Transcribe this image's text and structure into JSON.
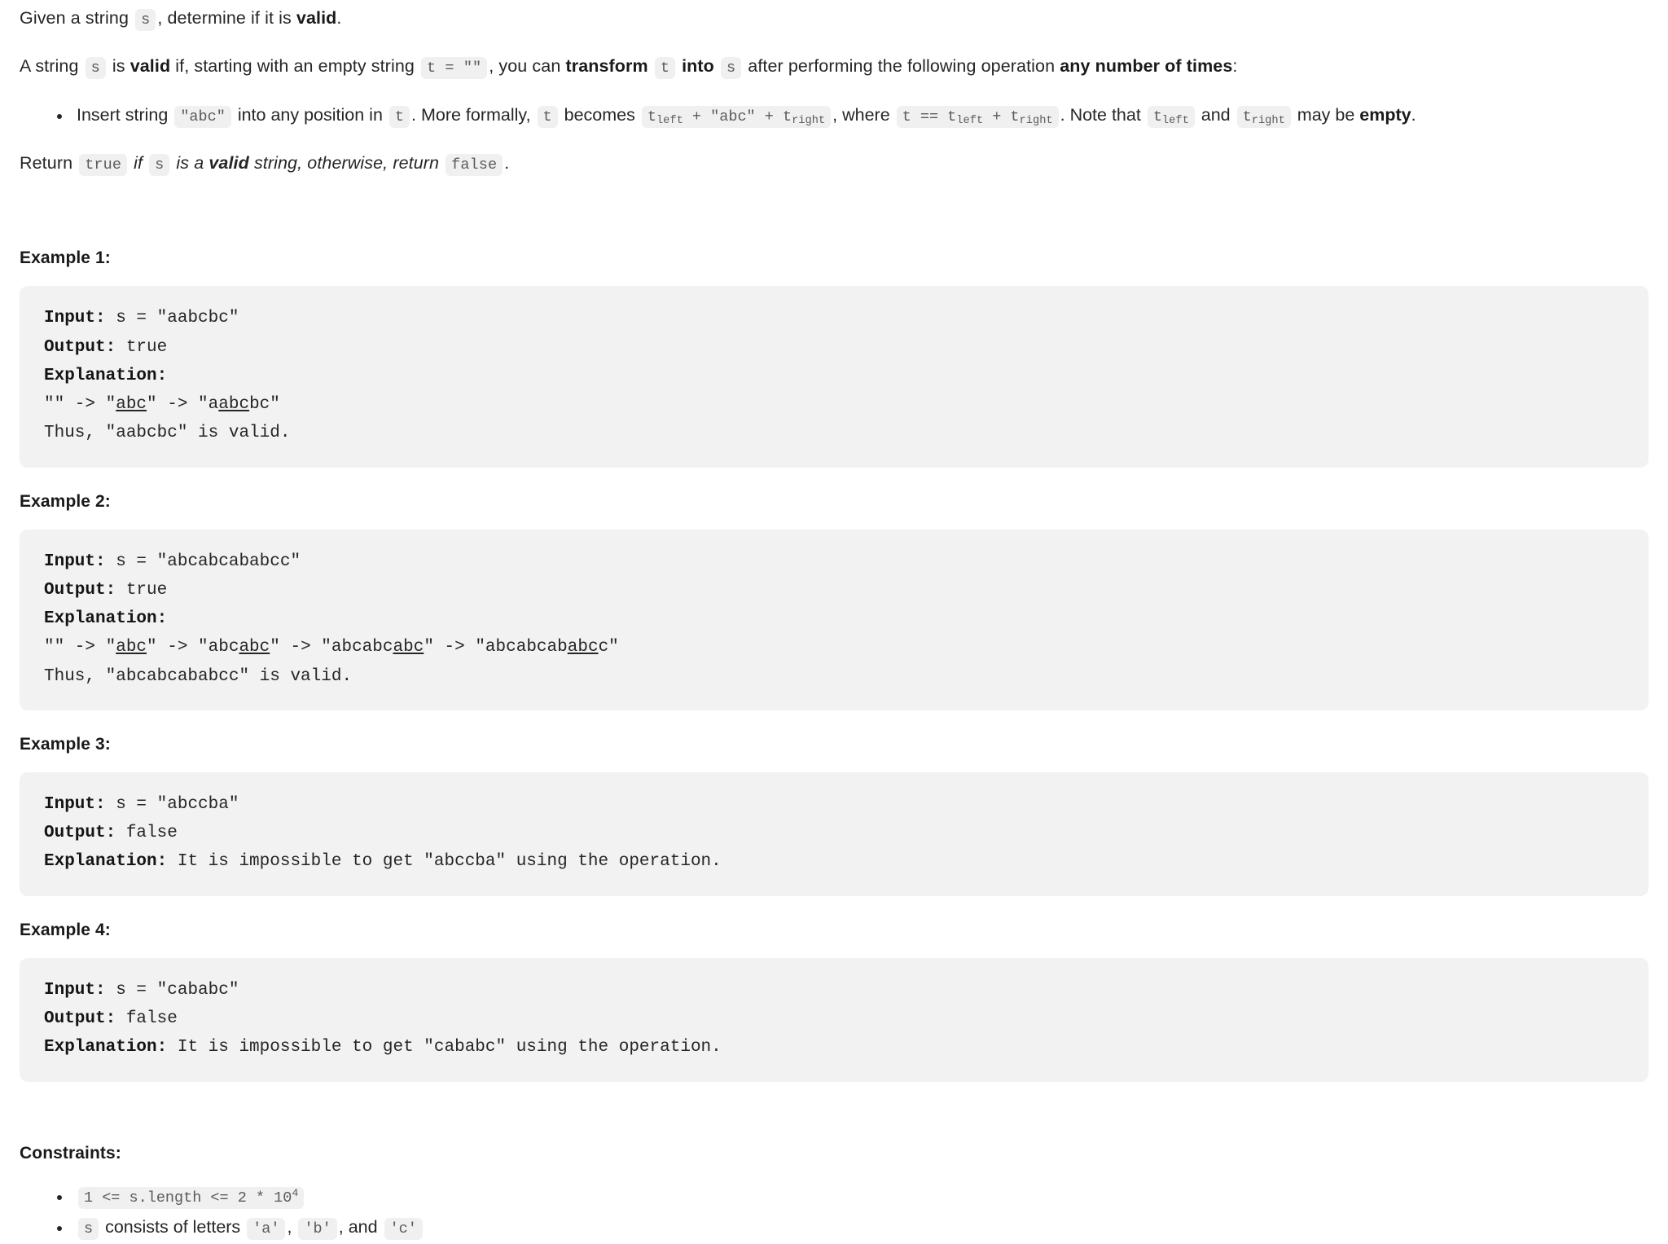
{
  "intro": {
    "line1": {
      "pre": "Given a string",
      "code_s": "s",
      "mid": ", determine if it is",
      "bold_valid": "valid",
      "post": "."
    },
    "line2": {
      "t1": "A string",
      "code_s": "s",
      "t2": "is",
      "bold_valid": "valid",
      "t3": "if, starting with an empty string",
      "code_t_empty": "t = \"\"",
      "t4": ", you can",
      "bold_transform": "transform",
      "code_t": "t",
      "bold_into": "into",
      "code_s2": "s",
      "t5": "after performing the following operation",
      "bold_any": "any number of times",
      "t6": ":"
    },
    "bullet": {
      "t1": "Insert string",
      "code_abc": "\"abc\"",
      "t2": "into any position in",
      "code_t": "t",
      "t3": ". More formally,",
      "code_t2": "t",
      "t4": "becomes",
      "code_formula": "t_left + \"abc\" + t_right",
      "t5": ", where",
      "code_eq": "t == t_left + t_right",
      "t6": ". Note that",
      "code_tleft": "t_left",
      "t7": "and",
      "code_tright": "t_right",
      "t8": "may be",
      "bold_empty": "empty",
      "t9": "."
    },
    "line3": {
      "t1": "Return",
      "code_true": "true",
      "t2": "if",
      "code_s": "s",
      "t3": "is a",
      "bold_valid": "valid",
      "t4": "string, otherwise, return",
      "code_false": "false",
      "t5": "."
    }
  },
  "examples": [
    {
      "heading": "Example 1:",
      "input_label": "Input:",
      "input_value": " s = \"aabcbc\"",
      "output_label": "Output:",
      "output_value": " true",
      "explanation_label": "Explanation:",
      "explanation_inline": "",
      "chain": [
        {
          "prefix": "\"\" -> \"",
          "pre": "",
          "underline": "abc",
          "post": "",
          "suffix": "\""
        },
        {
          "prefix": " -> \"",
          "pre": "a",
          "underline": "abc",
          "post": "bc",
          "suffix": "\""
        }
      ],
      "chain_text": "\"\" -> \"abc\" -> \"aabcbc\"",
      "closing": "Thus, \"aabcbc\" is valid."
    },
    {
      "heading": "Example 2:",
      "input_label": "Input:",
      "input_value": " s = \"abcabcababcc\"",
      "output_label": "Output:",
      "output_value": " true",
      "explanation_label": "Explanation:",
      "explanation_inline": "",
      "chain": [
        {
          "prefix": "\"\" -> \"",
          "pre": "",
          "underline": "abc",
          "post": "",
          "suffix": "\""
        },
        {
          "prefix": " -> \"",
          "pre": "abc",
          "underline": "abc",
          "post": "",
          "suffix": "\""
        },
        {
          "prefix": " -> \"",
          "pre": "abcabc",
          "underline": "abc",
          "post": "",
          "suffix": "\""
        },
        {
          "prefix": " -> \"",
          "pre": "abcabcab",
          "underline": "abc",
          "post": "c",
          "suffix": "\""
        }
      ],
      "chain_text": "\"\" -> \"abc\" -> \"abcabc\" -> \"abcabcabc\" -> \"abcabcababcc\"",
      "closing": "Thus, \"abcabcababcc\" is valid."
    },
    {
      "heading": "Example 3:",
      "input_label": "Input:",
      "input_value": " s = \"abccba\"",
      "output_label": "Output:",
      "output_value": " false",
      "explanation_label": "Explanation:",
      "explanation_inline": " It is impossible to get \"abccba\" using the operation.",
      "chain": [],
      "chain_text": "",
      "closing": ""
    },
    {
      "heading": "Example 4:",
      "input_label": "Input:",
      "input_value": " s = \"cababc\"",
      "output_label": "Output:",
      "output_value": " false",
      "explanation_label": "Explanation:",
      "explanation_inline": " It is impossible to get \"cababc\" using the operation.",
      "chain": [],
      "chain_text": "",
      "closing": ""
    }
  ],
  "constraints": {
    "heading": "Constraints:",
    "items": [
      {
        "kind": "code",
        "code_prefix": "1 <= s.length <= 2 * 10",
        "exponent": "4"
      },
      {
        "kind": "mixed",
        "code_s": "s",
        "text": "consists of letters",
        "code_a": "'a'",
        "comma1": ",",
        "code_b": "'b'",
        "comma2": ", and",
        "code_c": "'c'"
      }
    ]
  },
  "colors": {
    "page_background": "#ffffff",
    "text": "#262626",
    "heading": "#1a1a1a",
    "code_block_background": "#f2f2f2",
    "inline_code_background": "#f0f0f0",
    "inline_code_text": "#5b5b5b"
  }
}
